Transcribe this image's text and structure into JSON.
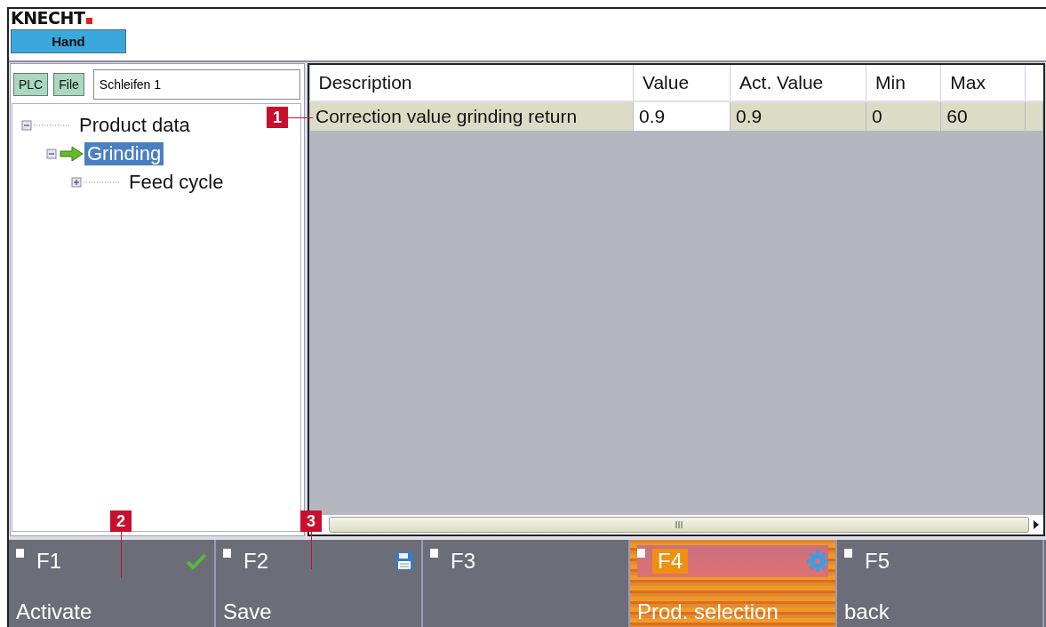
{
  "header": {
    "logo": "KNECHT",
    "mode": "Hand"
  },
  "toolbar": {
    "buttons": [
      "PLC",
      "File"
    ],
    "program_field": "Schleifen 1"
  },
  "tree": [
    {
      "label": "Product data",
      "expanded": true,
      "selected": false,
      "children": [
        {
          "label": "Grinding",
          "expanded": true,
          "selected": true,
          "children": [
            {
              "label": "Feed cycle",
              "expanded": false,
              "selected": false
            }
          ]
        }
      ]
    }
  ],
  "table": {
    "columns": [
      "Description",
      "Value",
      "Act. Value",
      "Min",
      "Max"
    ],
    "rows": [
      {
        "cells": [
          "Correction value grinding return",
          "0.9",
          "0.9",
          "0",
          "60"
        ]
      }
    ]
  },
  "function_keys": [
    {
      "key": "F1",
      "label": "Activate",
      "kind": "check",
      "selected": false
    },
    {
      "key": "F2",
      "label": "Save",
      "kind": "disk",
      "selected": false
    },
    {
      "key": "F3",
      "kind": "plain",
      "selected": false
    },
    {
      "key": "F4",
      "label": "Prod. selection",
      "kind": "gear",
      "selected": true
    },
    {
      "key": "F5",
      "label": "back",
      "kind": "plain",
      "selected": false
    }
  ],
  "callouts": [
    {
      "label": "1"
    },
    {
      "label": "2"
    },
    {
      "label": "3"
    }
  ]
}
